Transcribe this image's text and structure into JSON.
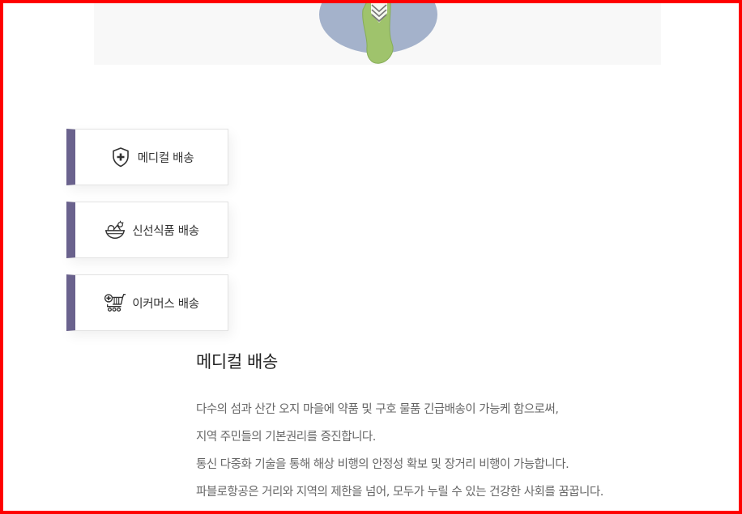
{
  "tabs": [
    {
      "label": "메디컬 배송",
      "icon": "medical-shield-icon"
    },
    {
      "label": "신선식품 배송",
      "icon": "fresh-food-bowl-icon"
    },
    {
      "label": "이커머스 배송",
      "icon": "shopping-cart-icon"
    }
  ],
  "colors": {
    "tab_accent": "#6a628d",
    "body_text": "#666666"
  },
  "content": {
    "title": "메디컬 배송",
    "lines": [
      "다수의 섬과 산간 오지 마을에 약품 및 구호 물품 긴급배송이 가능케 함으로써,",
      "지역 주민들의 기본권리를 증진합니다.",
      "통신 다중화 기술을 통해 해상 비행의 안정성 확보 및 장거리 비행이 가능합니다.",
      "파블로항공은 거리와 지역의 제한을 넘어, 모두가 누릴 수 있는 건강한 사회를 꿈꿉니다."
    ]
  }
}
